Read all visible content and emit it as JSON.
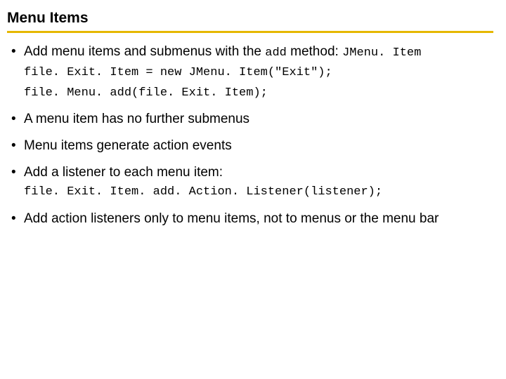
{
  "title": "Menu Items",
  "bullets": {
    "b1": {
      "lead": "Add menu items and submenus with the ",
      "code1": "add",
      "mid": " method: ",
      "code2": "JMenu. Item",
      "block_l1": "file. Exit. Item = new JMenu. Item(\"Exit\");",
      "block_l2": "file. Menu. add(file. Exit. Item);"
    },
    "b2": {
      "text": "A menu item has no further submenus"
    },
    "b3": {
      "text": "Menu items generate action events"
    },
    "b4": {
      "text": "Add a listener to each menu item:",
      "block": "file. Exit. Item. add. Action. Listener(listener);"
    },
    "b5": {
      "text": "Add action listeners only to menu items, not to menus or the menu bar"
    }
  }
}
